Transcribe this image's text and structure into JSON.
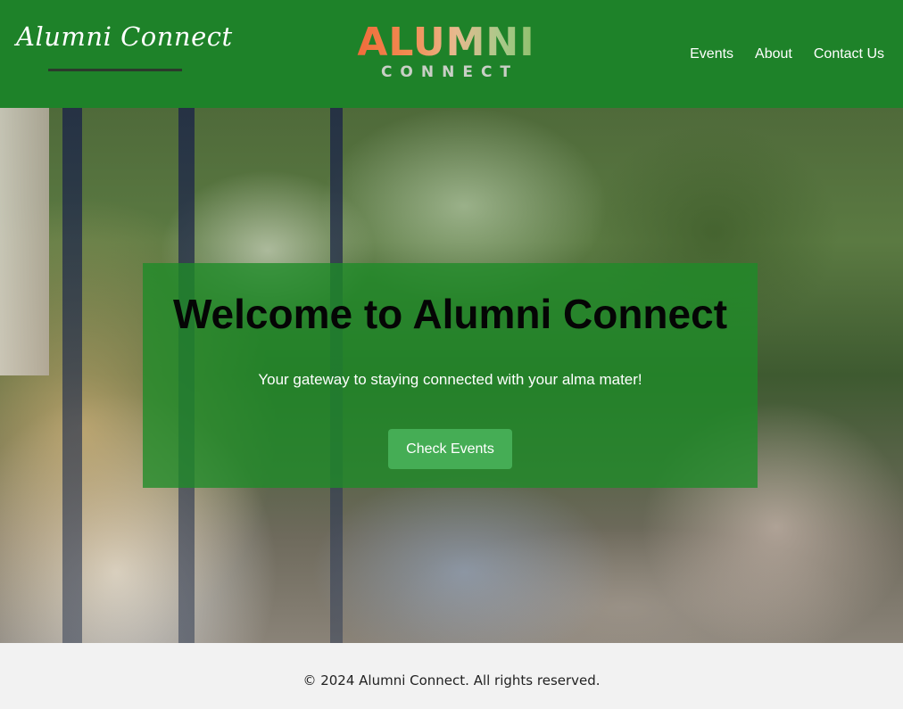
{
  "header": {
    "brand_text": "Alumni Connect",
    "logo_top": "ALUMNI",
    "logo_bottom": "CONNECT",
    "nav": [
      "Events",
      "About",
      "Contact Us"
    ]
  },
  "hero": {
    "title": "Welcome to Alumni Connect",
    "subtitle": "Your gateway to staying connected with your alma mater!",
    "cta_label": "Check Events",
    "background_description_icon": "students-photo"
  },
  "footer": {
    "text": "© 2024 Alumni Connect. All rights reserved."
  },
  "colors": {
    "header_bg": "#1e8229",
    "overlay": "rgba(30,140,40,0.78)",
    "button_bg": "#45ad55",
    "footer_bg": "#f2f2f2"
  }
}
